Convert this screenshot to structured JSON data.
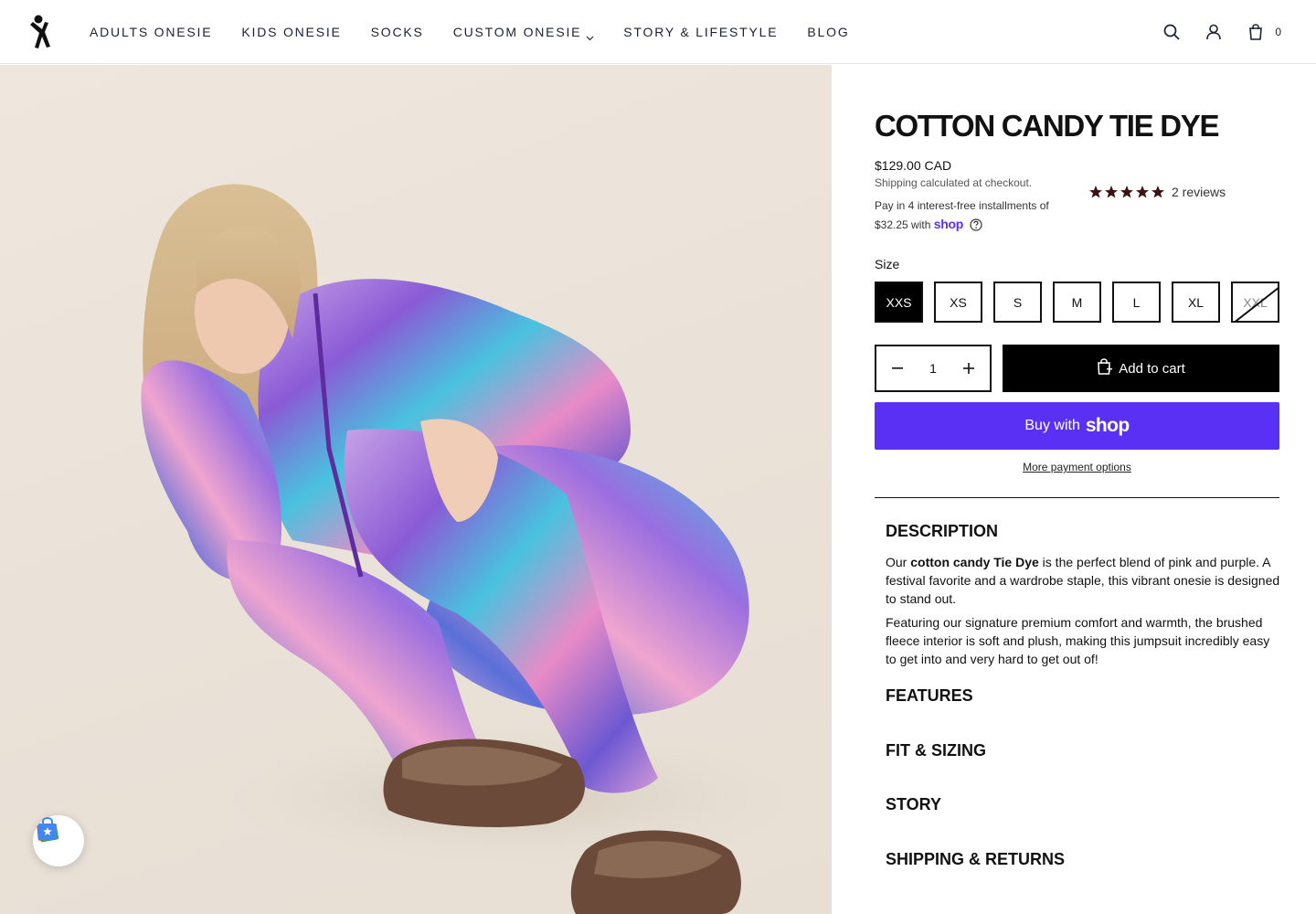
{
  "header": {
    "logo_name": "brand-logo",
    "nav": [
      {
        "label": "ADULTS ONESIE",
        "has_dropdown": false
      },
      {
        "label": "KIDS ONESIE",
        "has_dropdown": false
      },
      {
        "label": "SOCKS",
        "has_dropdown": false
      },
      {
        "label": "CUSTOM ONESIE",
        "has_dropdown": true
      },
      {
        "label": "STORY & LIFESTYLE",
        "has_dropdown": false
      },
      {
        "label": "BLOG",
        "has_dropdown": false
      }
    ],
    "icons": [
      "search-icon",
      "account-icon",
      "cart-icon"
    ],
    "cart_count": "0"
  },
  "hero": {
    "image": "woman crouching in a pink, purple and blue tie dye onesie"
  },
  "product": {
    "title": "COTTON CANDY TIE DYE",
    "price": "$129.00 CAD",
    "shipping_prefix": "Shipping",
    "shipping_suffix": " calculated at checkout.",
    "installments_text": "Pay in 4 interest-free installments of $32.25 with",
    "installments_brand": "shop",
    "rating": 5,
    "reviews_label": "2 reviews",
    "size_label": "Size",
    "sizes": [
      {
        "label": "XXS",
        "selected": true,
        "sold_out": false
      },
      {
        "label": "XS",
        "selected": false,
        "sold_out": false
      },
      {
        "label": "S",
        "selected": false,
        "sold_out": false
      },
      {
        "label": "M",
        "selected": false,
        "sold_out": false
      },
      {
        "label": "L",
        "selected": false,
        "sold_out": false
      },
      {
        "label": "XL",
        "selected": false,
        "sold_out": false
      },
      {
        "label": "XXL",
        "selected": false,
        "sold_out": true
      }
    ],
    "quantity": "1",
    "add_to_cart_label": "Add to cart",
    "buy_now_prefix": "Buy with",
    "buy_now_brand": "shop",
    "more_payment_label": "More payment options"
  },
  "accordion": {
    "description_heading": "DESCRIPTION",
    "description_p1_prefix": "Our ",
    "description_p1_bold": "cotton candy Tie Dye",
    "description_p1_suffix": " is the perfect blend of pink and purple. A festival favorite and a wardrobe staple, this vibrant onesie is designed to stand out.",
    "description_p2": "Featuring our signature premium comfort and warmth, the brushed fleece interior is soft and plush, making this jumpsuit incredibly easy to get into and very hard to get out of!",
    "features_heading": "FEATURES",
    "fit_heading": "FIT & SIZING",
    "story_heading": "STORY",
    "shipping_heading": "SHIPPING & RETURNS"
  },
  "colors": {
    "accent_shop": "#5a31f4",
    "primary_button": "#000000",
    "star": "#3a1414",
    "nav_text": "#1a2233"
  }
}
